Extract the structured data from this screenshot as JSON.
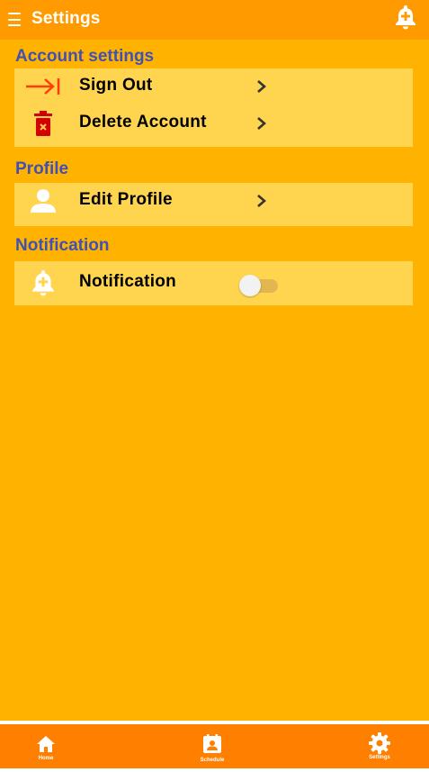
{
  "header": {
    "title": "Settings",
    "menu_icon": "hamburger-menu-icon",
    "action_icon": "bell-plus-icon"
  },
  "sections": [
    {
      "title": "Account settings",
      "items": [
        {
          "label": "Sign Out",
          "icon": "sign-out-arrow-icon",
          "control": "chevron"
        },
        {
          "label": "Delete Account",
          "icon": "trash-delete-icon",
          "control": "chevron"
        }
      ]
    },
    {
      "title": "Profile",
      "items": [
        {
          "label": "Edit Profile",
          "icon": "person-icon",
          "control": "chevron"
        }
      ]
    },
    {
      "title": "Notification",
      "items": [
        {
          "label": "Notification",
          "icon": "bell-plus-icon",
          "control": "toggle",
          "toggle_on": false
        }
      ]
    }
  ],
  "bottom_nav": [
    {
      "label": "Home",
      "icon": "home-icon"
    },
    {
      "label": "Schedule",
      "icon": "schedule-icon"
    },
    {
      "label": "Settings",
      "icon": "gear-icon"
    }
  ],
  "colors": {
    "background": "#ffb300",
    "header": "#ff9a00",
    "card": "#ffd54f",
    "section_title": "#3f51b5",
    "bottom_nav": "#ff7f00",
    "sign_out_icon": "#ff3d00",
    "delete_icon": "#d50000"
  }
}
